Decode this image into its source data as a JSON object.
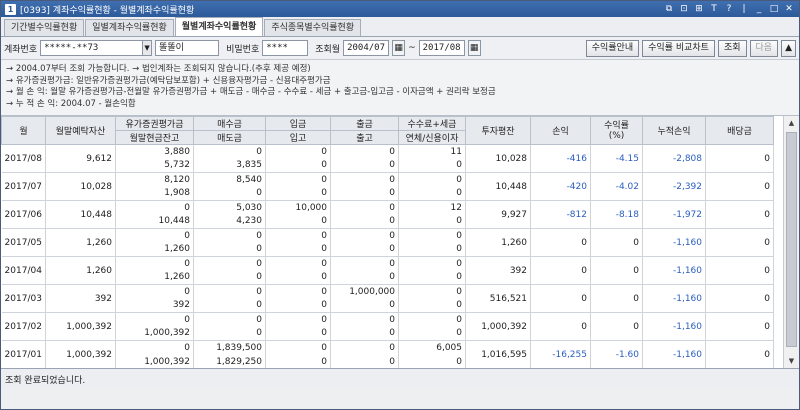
{
  "window": {
    "icon_text": "1",
    "title": "[0393] 계좌수익률현황 - 월별계좌수익률현황",
    "controls": [
      "⧉",
      "⊡",
      "⊞",
      "T",
      "?",
      "|",
      "_",
      "□",
      "✕"
    ]
  },
  "tabs": [
    {
      "label": "기간별수익률현황",
      "active": false
    },
    {
      "label": "일별계좌수익률현황",
      "active": false
    },
    {
      "label": "월별계좌수익률현황",
      "active": true
    },
    {
      "label": "주식종목별수익률현황",
      "active": false
    }
  ],
  "search": {
    "account_label": "계좌번호",
    "account_value": "*****-**73",
    "owner_value": "똘똘이",
    "password_label": "비밀번호",
    "password_value": "****",
    "month_label": "조회월",
    "from_month": "2004/07",
    "tilde": "~",
    "to_month": "2017/08",
    "buttons": {
      "guide": "수익률안내",
      "compare_chart": "수익률 비교차트",
      "query": "조회",
      "next": "다음",
      "up": "▲"
    }
  },
  "notes": [
    "→ 2004.07부터 조회 가능합니다. → 법인계좌는 조회되지 않습니다.(추후 제공 예정)",
    "→ 유가증권평가금: 일반유가증권평가금(예탁담보포함) + 신용융자평가금 - 신용대주평가금",
    "→ 월 손 익: 월말 유가증권평가금-전월말 유가증권평가금 + 매도금 - 매수금 - 수수료 - 세금 + 출고금-입고금 - 이자금액 + 권리락 보정금",
    "→ 누 적 손 익: 2004.07 - 월손익합"
  ],
  "table": {
    "headers": {
      "month": "월",
      "deposit": "월말예탁자산",
      "securities_top": "유가증권평가금",
      "securities_bottom": "월말현금잔고",
      "buy_top": "매수금",
      "buy_bottom": "매도금",
      "in_top": "입금",
      "in_bottom": "입고",
      "out_top": "출금",
      "out_bottom": "출고",
      "fee_top": "수수료+세금",
      "fee_bottom": "연체/신용이자",
      "invest": "투자평잔",
      "pnl": "손익",
      "rate": "수익률\n(%)",
      "cum": "누적손익",
      "div": "배당금"
    },
    "rows": [
      {
        "month": "2017/08",
        "deposit": "9,612",
        "sec": "3,880",
        "cash": "5,732",
        "buy": "0",
        "sell": "3,835",
        "dep": "0",
        "recv": "0",
        "wd": "0",
        "ship": "0",
        "fee": "11",
        "int": "0",
        "invest": "10,028",
        "pnl": "-416",
        "rate": "-4.15",
        "cum": "-2,808",
        "div": "0"
      },
      {
        "month": "2017/07",
        "deposit": "10,028",
        "sec": "8,120",
        "cash": "1,908",
        "buy": "8,540",
        "sell": "0",
        "dep": "0",
        "recv": "0",
        "wd": "0",
        "ship": "0",
        "fee": "0",
        "int": "0",
        "invest": "10,448",
        "pnl": "-420",
        "rate": "-4.02",
        "cum": "-2,392",
        "div": "0"
      },
      {
        "month": "2017/06",
        "deposit": "10,448",
        "sec": "0",
        "cash": "10,448",
        "buy": "5,030",
        "sell": "4,230",
        "dep": "10,000",
        "recv": "0",
        "wd": "0",
        "ship": "0",
        "fee": "12",
        "int": "0",
        "invest": "9,927",
        "pnl": "-812",
        "rate": "-8.18",
        "cum": "-1,972",
        "div": "0"
      },
      {
        "month": "2017/05",
        "deposit": "1,260",
        "sec": "0",
        "cash": "1,260",
        "buy": "0",
        "sell": "0",
        "dep": "0",
        "recv": "0",
        "wd": "0",
        "ship": "0",
        "fee": "0",
        "int": "0",
        "invest": "1,260",
        "pnl": "0",
        "rate": "0",
        "cum": "-1,160",
        "div": "0"
      },
      {
        "month": "2017/04",
        "deposit": "1,260",
        "sec": "0",
        "cash": "1,260",
        "buy": "0",
        "sell": "0",
        "dep": "0",
        "recv": "0",
        "wd": "0",
        "ship": "0",
        "fee": "0",
        "int": "0",
        "invest": "392",
        "pnl": "0",
        "rate": "0",
        "cum": "-1,160",
        "div": "0"
      },
      {
        "month": "2017/03",
        "deposit": "392",
        "sec": "0",
        "cash": "392",
        "buy": "0",
        "sell": "0",
        "dep": "0",
        "recv": "0",
        "wd": "1,000,000",
        "ship": "0",
        "fee": "0",
        "int": "0",
        "invest": "516,521",
        "pnl": "0",
        "rate": "0",
        "cum": "-1,160",
        "div": "0"
      },
      {
        "month": "2017/02",
        "deposit": "1,000,392",
        "sec": "0",
        "cash": "1,000,392",
        "buy": "0",
        "sell": "0",
        "dep": "0",
        "recv": "0",
        "wd": "0",
        "ship": "0",
        "fee": "0",
        "int": "0",
        "invest": "1,000,392",
        "pnl": "0",
        "rate": "0",
        "cum": "-1,160",
        "div": "0"
      },
      {
        "month": "2017/01",
        "deposit": "1,000,392",
        "sec": "0",
        "cash": "1,000,392",
        "buy": "1,839,500",
        "sell": "1,829,250",
        "dep": "0",
        "recv": "0",
        "wd": "0",
        "ship": "0",
        "fee": "6,005",
        "int": "0",
        "invest": "1,016,595",
        "pnl": "-16,255",
        "rate": "-1.60",
        "cum": "-1,160",
        "div": "0"
      }
    ]
  },
  "status": "조회 완료되었습니다."
}
